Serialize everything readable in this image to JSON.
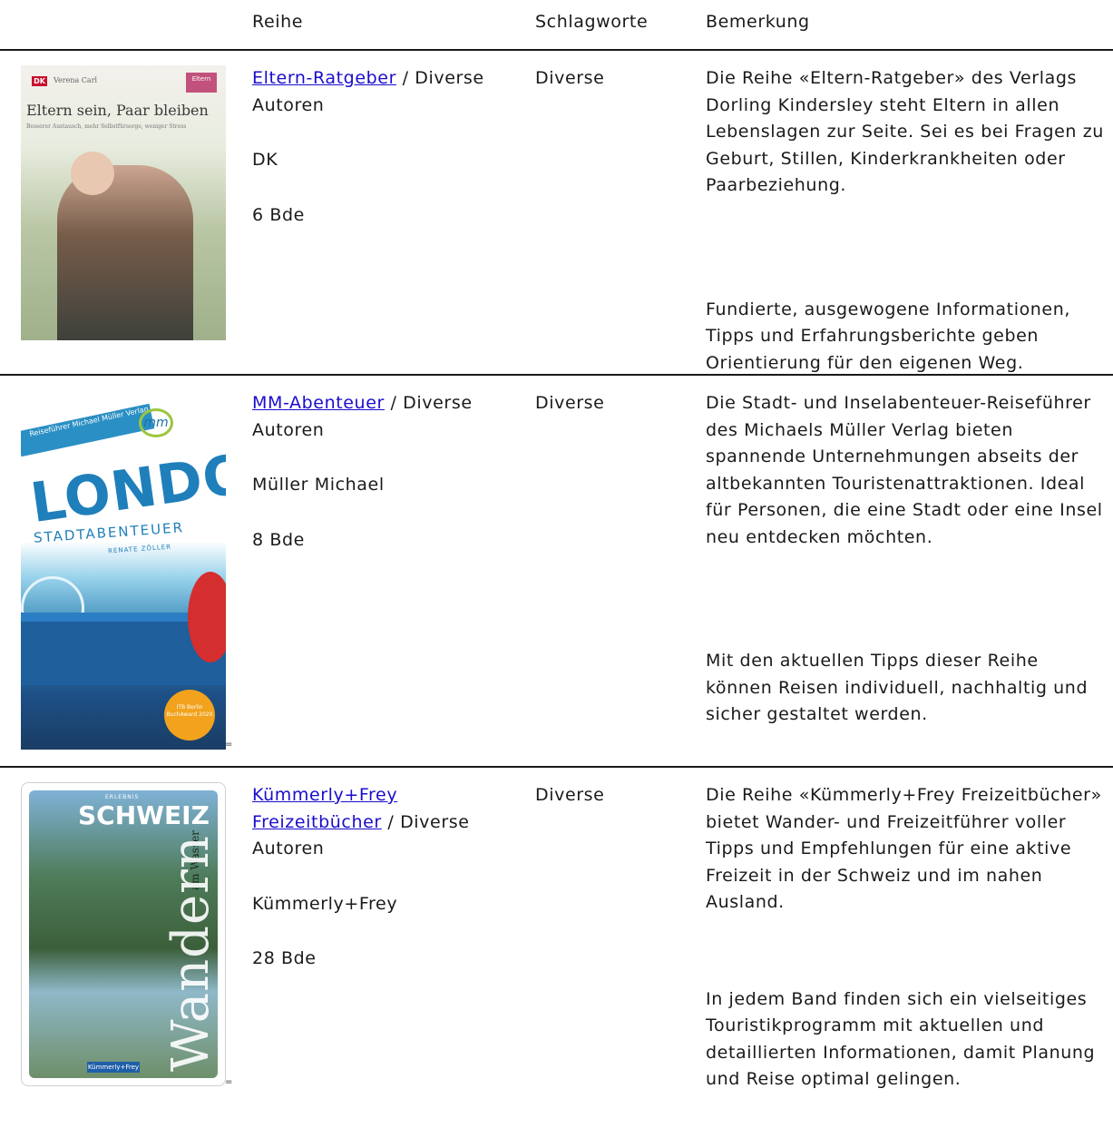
{
  "header": {
    "col_reihe": "Reihe",
    "col_schlagworte": "Schlagworte",
    "col_bemerkung": "Bemerkung"
  },
  "rows": [
    {
      "series_link": "Eltern-Ratgeber",
      "series_suffix": " / Diverse Autoren",
      "publisher": "DK",
      "volumes": "6 Bde",
      "keywords": "Diverse",
      "remark_1": "Die Reihe «Eltern-Ratgeber» des Verlags Dorling Kindersley steht Eltern in allen Lebenslagen zur Seite. Sei es bei Fragen zu Geburt, Stillen, Kinderkrankheiten oder Paarbeziehung.",
      "remark_2": "Fundierte, ausgewogene Informationen, Tipps und Erfahrungsberichte geben Orientierung für den eigenen Weg.",
      "cover": {
        "logo": "DK",
        "author": "Verena Carl",
        "badge": "Eltern",
        "title": "Eltern sein, Paar bleiben",
        "subtitle": "Besserer Austausch, mehr Selbstfürsorge, weniger Stress"
      }
    },
    {
      "series_link": "MM-Abenteuer",
      "series_suffix": " / Diverse Autoren",
      "publisher": "Müller Michael",
      "volumes": "8 Bde",
      "keywords": "Diverse",
      "remark_1": "Die Stadt- und Inselabenteuer-Reiseführer des Michaels Müller Verlag bieten spannende Unternehmungen abseits der altbekannten Touristenattraktionen. Ideal für Personen, die eine Stadt oder eine Insel neu entdecken möchten.",
      "remark_2": "Mit den aktuellen Tipps dieser Reihe können Reisen individuell, nachhaltig und sicher gestaltet werden.",
      "cover": {
        "tag": "Reiseführer Michael Müller Verlag",
        "mark": "mm",
        "title": "LONDON",
        "subtitle": "STADTABENTEUER",
        "author": "RENATE ZÖLLER",
        "seal": "ITB Berlin BuchAward 2020"
      }
    },
    {
      "series_link": "Kümmerly+Frey Freizeitbücher",
      "series_suffix": " / Diverse Autoren",
      "publisher": "Kümmerly+Frey",
      "volumes": "28 Bde",
      "keywords": "Diverse",
      "remark_1": "Die Reihe «Kümmerly+Frey Freizeitbücher» bietet Wander- und Freizeitführer voller Tipps und Empfehlungen für eine aktive Freizeit in der Schweiz und im nahen Ausland.",
      "remark_2": "In jedem Band finden sich ein vielseitiges Touristikprogramm mit aktuellen und detaillierten Informationen, damit Planung und Reise optimal gelingen.",
      "cover": {
        "over": "ERLEBNIS",
        "brand": "SCHWEIZ",
        "side": "am Wasser",
        "title": "Wandern",
        "publisher": "Kümmerly+Frey"
      }
    }
  ],
  "marker": "="
}
